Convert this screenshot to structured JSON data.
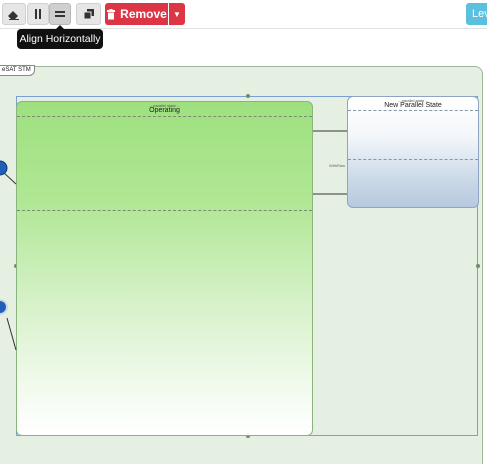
{
  "toolbar": {
    "remove_label": "Remove",
    "level_label": "Lev",
    "tooltip": "Align Horizontally"
  },
  "diagram": {
    "stm_label": "eSAT STM",
    "operating": {
      "sublabel": "-- parallel state --",
      "name": "Operating"
    },
    "parallel_state": {
      "sublabel": "-- parallel state --",
      "name": "New Parallel State"
    },
    "transition_label": "WithRaw"
  },
  "colors": {
    "remove": "#dc3545",
    "level": "#5bc0de",
    "canvas": "#e5efe2",
    "operating_top": "#9ee07f",
    "parallel_bottom": "#b6c9de",
    "selection": "#7a9fd4"
  },
  "icons": [
    "eraser-icon",
    "align-vertical-icon",
    "align-horizontal-icon",
    "clone-icon",
    "trash-icon",
    "caret-down-icon"
  ]
}
